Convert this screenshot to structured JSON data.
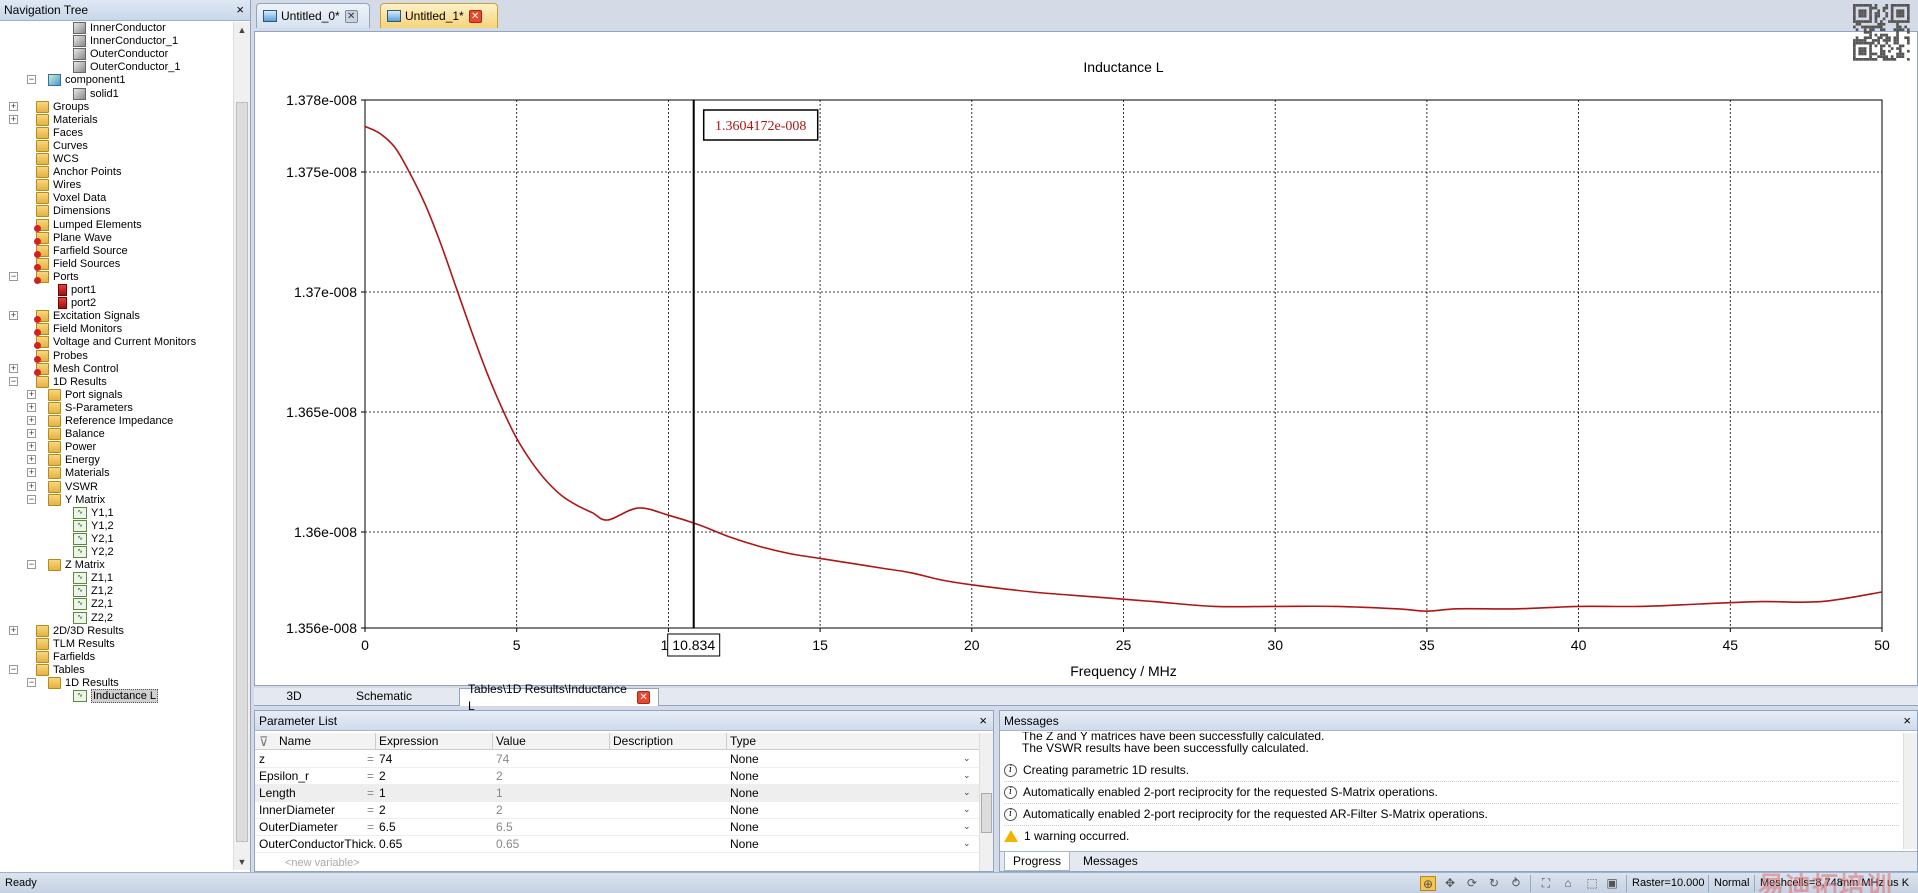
{
  "nav": {
    "title": "Navigation Tree",
    "close_glyph": "×",
    "items": [
      {
        "label": "InnerConductor",
        "depth": 4,
        "icon": "solid",
        "exp": ""
      },
      {
        "label": "InnerConductor_1",
        "depth": 4,
        "icon": "solid",
        "exp": ""
      },
      {
        "label": "OuterConductor",
        "depth": 4,
        "icon": "solid",
        "exp": ""
      },
      {
        "label": "OuterConductor_1",
        "depth": 4,
        "icon": "solid",
        "exp": ""
      },
      {
        "label": "component1",
        "depth": 2,
        "icon": "comp",
        "exp": "−"
      },
      {
        "label": "solid1",
        "depth": 4,
        "icon": "solid",
        "exp": ""
      },
      {
        "label": "Groups",
        "depth": 1,
        "icon": "folder",
        "exp": "+"
      },
      {
        "label": "Materials",
        "depth": 1,
        "icon": "folder",
        "exp": "+"
      },
      {
        "label": "Faces",
        "depth": 1,
        "icon": "folder",
        "exp": ""
      },
      {
        "label": "Curves",
        "depth": 1,
        "icon": "folder",
        "exp": ""
      },
      {
        "label": "WCS",
        "depth": 1,
        "icon": "folder",
        "exp": ""
      },
      {
        "label": "Anchor Points",
        "depth": 1,
        "icon": "folder",
        "exp": ""
      },
      {
        "label": "Wires",
        "depth": 1,
        "icon": "folder",
        "exp": ""
      },
      {
        "label": "Voxel Data",
        "depth": 1,
        "icon": "folder",
        "exp": ""
      },
      {
        "label": "Dimensions",
        "depth": 1,
        "icon": "folder",
        "exp": ""
      },
      {
        "label": "Lumped Elements",
        "depth": 1,
        "icon": "folder-red",
        "exp": ""
      },
      {
        "label": "Plane Wave",
        "depth": 1,
        "icon": "folder-red",
        "exp": ""
      },
      {
        "label": "Farfield Source",
        "depth": 1,
        "icon": "folder-red",
        "exp": ""
      },
      {
        "label": "Field Sources",
        "depth": 1,
        "icon": "folder-red",
        "exp": ""
      },
      {
        "label": "Ports",
        "depth": 1,
        "icon": "folder-red",
        "exp": "−"
      },
      {
        "label": "port1",
        "depth": 3,
        "icon": "port",
        "exp": ""
      },
      {
        "label": "port2",
        "depth": 3,
        "icon": "port",
        "exp": ""
      },
      {
        "label": "Excitation Signals",
        "depth": 1,
        "icon": "folder-red",
        "exp": "+"
      },
      {
        "label": "Field Monitors",
        "depth": 1,
        "icon": "folder-red",
        "exp": ""
      },
      {
        "label": "Voltage and Current Monitors",
        "depth": 1,
        "icon": "folder-red",
        "exp": ""
      },
      {
        "label": "Probes",
        "depth": 1,
        "icon": "folder-red",
        "exp": ""
      },
      {
        "label": "Mesh Control",
        "depth": 1,
        "icon": "folder-red",
        "exp": "+"
      },
      {
        "label": "1D Results",
        "depth": 1,
        "icon": "folder",
        "exp": "−"
      },
      {
        "label": "Port signals",
        "depth": 2,
        "icon": "folder",
        "exp": "+"
      },
      {
        "label": "S-Parameters",
        "depth": 2,
        "icon": "folder",
        "exp": "+"
      },
      {
        "label": "Reference Impedance",
        "depth": 2,
        "icon": "folder",
        "exp": "+"
      },
      {
        "label": "Balance",
        "depth": 2,
        "icon": "folder",
        "exp": "+"
      },
      {
        "label": "Power",
        "depth": 2,
        "icon": "folder",
        "exp": "+"
      },
      {
        "label": "Energy",
        "depth": 2,
        "icon": "folder",
        "exp": "+"
      },
      {
        "label": "Materials",
        "depth": 2,
        "icon": "folder",
        "exp": "+"
      },
      {
        "label": "VSWR",
        "depth": 2,
        "icon": "folder",
        "exp": "+"
      },
      {
        "label": "Y Matrix",
        "depth": 2,
        "icon": "folder",
        "exp": "−"
      },
      {
        "label": "Y1,1",
        "depth": 4,
        "icon": "result",
        "exp": ""
      },
      {
        "label": "Y1,2",
        "depth": 4,
        "icon": "result",
        "exp": ""
      },
      {
        "label": "Y2,1",
        "depth": 4,
        "icon": "result",
        "exp": ""
      },
      {
        "label": "Y2,2",
        "depth": 4,
        "icon": "result",
        "exp": ""
      },
      {
        "label": "Z Matrix",
        "depth": 2,
        "icon": "folder",
        "exp": "−"
      },
      {
        "label": "Z1,1",
        "depth": 4,
        "icon": "result",
        "exp": ""
      },
      {
        "label": "Z1,2",
        "depth": 4,
        "icon": "result",
        "exp": ""
      },
      {
        "label": "Z2,1",
        "depth": 4,
        "icon": "result",
        "exp": ""
      },
      {
        "label": "Z2,2",
        "depth": 4,
        "icon": "result",
        "exp": ""
      },
      {
        "label": "2D/3D Results",
        "depth": 1,
        "icon": "folder",
        "exp": "+"
      },
      {
        "label": "TLM Results",
        "depth": 1,
        "icon": "folder",
        "exp": ""
      },
      {
        "label": "Farfields",
        "depth": 1,
        "icon": "folder",
        "exp": ""
      },
      {
        "label": "Tables",
        "depth": 1,
        "icon": "folder",
        "exp": "−"
      },
      {
        "label": "1D Results",
        "depth": 2,
        "icon": "folder",
        "exp": "−"
      },
      {
        "label": "Inductance L",
        "depth": 4,
        "icon": "result",
        "exp": "",
        "selected": true
      }
    ]
  },
  "tabs": [
    {
      "label": "Untitled_0*",
      "active": false
    },
    {
      "label": "Untitled_1*",
      "active": true
    }
  ],
  "view_tabs": [
    "3D",
    "Schematic",
    "Tables\\1D Results\\Inductance L"
  ],
  "chart_data": {
    "type": "line",
    "title": "Inductance L",
    "xlabel": "Frequency / MHz",
    "ylabel": "",
    "xlim": [
      0,
      50
    ],
    "ylim": [
      1.356e-08,
      1.378e-08
    ],
    "x_ticks": [
      "0",
      "5",
      "10",
      "15",
      "20",
      "25",
      "30",
      "35",
      "40",
      "45",
      "50"
    ],
    "y_ticks": [
      {
        "v": 1.356e-08,
        "label": "1.356e-008"
      },
      {
        "v": 1.36e-08,
        "label": "1.36e-008"
      },
      {
        "v": 1.365e-08,
        "label": "1.365e-008"
      },
      {
        "v": 1.37e-08,
        "label": "1.37e-008"
      },
      {
        "v": 1.375e-08,
        "label": "1.375e-008"
      },
      {
        "v": 1.378e-08,
        "label": "1.378e-008"
      }
    ],
    "grid": true,
    "series_color": "#b01515",
    "x": [
      0,
      0.5,
      1,
      1.5,
      2,
      2.5,
      3,
      3.5,
      4,
      4.5,
      5,
      5.5,
      6,
      6.5,
      7,
      7.5,
      8,
      9,
      10,
      11,
      12,
      13,
      14,
      15,
      16,
      17,
      18,
      19,
      20,
      22,
      24,
      26,
      28,
      30,
      32,
      34,
      35,
      36,
      38,
      40,
      42,
      44,
      46,
      48,
      50
    ],
    "y": [
      1.3769e-08,
      1.3766e-08,
      1.376e-08,
      1.3749e-08,
      1.3736e-08,
      1.372e-08,
      1.3702e-08,
      1.3684e-08,
      1.3667e-08,
      1.3652e-08,
      1.3639e-08,
      1.3629e-08,
      1.3621e-08,
      1.3615e-08,
      1.3611e-08,
      1.3608e-08,
      1.3605e-08,
      1.361e-08,
      1.3607e-08,
      1.3603e-08,
      1.3598e-08,
      1.3594e-08,
      1.3591e-08,
      1.3589e-08,
      1.3587e-08,
      1.3585e-08,
      1.3583e-08,
      1.358e-08,
      1.3578e-08,
      1.3575e-08,
      1.3573e-08,
      1.3571e-08,
      1.3569e-08,
      1.3569e-08,
      1.3569e-08,
      1.3568e-08,
      1.3567e-08,
      1.3568e-08,
      1.3568e-08,
      1.3569e-08,
      1.3569e-08,
      1.357e-08,
      1.3571e-08,
      1.3571e-08,
      1.3575e-08
    ],
    "marker_x": 10.834,
    "marker_x_label": "10.834",
    "marker_value_label": "1.3604172e-008"
  },
  "param_panel": {
    "title": "Parameter List",
    "close_glyph": "×",
    "columns": [
      "Name",
      "Expression",
      "Value",
      "Description",
      "Type"
    ],
    "rows": [
      {
        "name": "z",
        "eq": "=",
        "expr": "74",
        "value": "74",
        "type": "None"
      },
      {
        "name": "Epsilon_r",
        "eq": "=",
        "expr": "2",
        "value": "2",
        "type": "None"
      },
      {
        "name": "Length",
        "eq": "=",
        "expr": "1",
        "value": "1",
        "type": "None"
      },
      {
        "name": "InnerDiameter",
        "eq": "=",
        "expr": "2",
        "value": "2",
        "type": "None"
      },
      {
        "name": "OuterDiameter",
        "eq": "=",
        "expr": "6.5",
        "value": "6.5",
        "type": "None"
      },
      {
        "name": "OuterConductorThick...",
        "eq": "=",
        "expr": "0.65",
        "value": "0.65",
        "type": "None"
      }
    ],
    "new_variable": "<new variable>"
  },
  "messages_panel": {
    "title": "Messages",
    "close_glyph": "×",
    "lines": [
      {
        "icon": "",
        "text": "The Z and Y matrices have been successfully calculated."
      },
      {
        "icon": "",
        "text": "The VSWR results have been successfully calculated."
      },
      {
        "icon": "info",
        "text": "Creating parametric 1D results."
      },
      {
        "icon": "info",
        "text": "Automatically enabled 2-port reciprocity for the requested S-Matrix operations."
      },
      {
        "icon": "info",
        "text": "Automatically enabled 2-port reciprocity for the requested AR-Filter S-Matrix operations."
      },
      {
        "icon": "warn",
        "text": "1 warning occurred."
      }
    ],
    "tabs": [
      "Progress",
      "Messages"
    ]
  },
  "status": {
    "ready": "Ready",
    "raster": "Raster=10.000",
    "mode": "Normal",
    "meshcells": "Meshcells=8,748",
    "units": "mm  MHz  us  K"
  },
  "watermark": {
    "text": "易迪拓培训"
  }
}
